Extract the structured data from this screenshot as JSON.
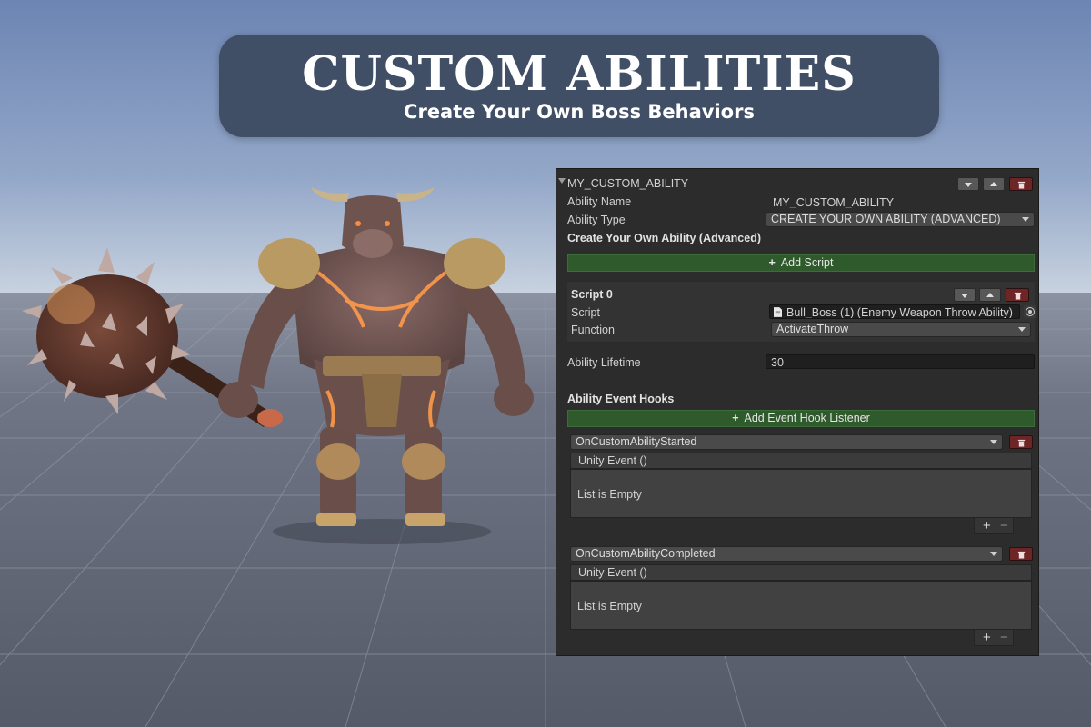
{
  "banner": {
    "title": "CUSTOM ABILITIES",
    "subtitle": "Create Your Own Boss Behaviors"
  },
  "inspector": {
    "foldout_title": "MY_CUSTOM_ABILITY",
    "ability_name_label": "Ability Name",
    "ability_name_value": "MY_CUSTOM_ABILITY",
    "ability_type_label": "Ability Type",
    "ability_type_value": "CREATE YOUR OWN ABILITY (ADVANCED)",
    "section_heading": "Create Your Own Ability (Advanced)",
    "add_script_label": "Add Script",
    "script": {
      "title": "Script 0",
      "script_label": "Script",
      "script_value": "Bull_Boss (1) (Enemy Weapon Throw Ability)",
      "function_label": "Function",
      "function_value": "ActivateThrow"
    },
    "lifetime_label": "Ability Lifetime",
    "lifetime_value": "30",
    "event_hooks_heading": "Ability Event Hooks",
    "add_listener_label": "Add Event Hook Listener",
    "events": [
      {
        "name": "OnCustomAbilityStarted",
        "event_label": "Unity Event ()",
        "empty_text": "List is Empty",
        "plus": "+",
        "minus": "−"
      },
      {
        "name": "OnCustomAbilityCompleted",
        "event_label": "Unity Event ()",
        "empty_text": "List is Empty",
        "plus": "+",
        "minus": "−"
      }
    ]
  },
  "colors": {
    "sky": "#6f86b2",
    "ground": "#5c6170",
    "panel": "#2c2c2c",
    "green_button": "#2f5a2c",
    "delete_button": "#6e2525",
    "banner": "#404f66"
  },
  "icons": [
    "chevron-down-icon",
    "chevron-up-icon",
    "trash-icon",
    "plus-icon",
    "script-file-icon",
    "target-picker-icon"
  ]
}
